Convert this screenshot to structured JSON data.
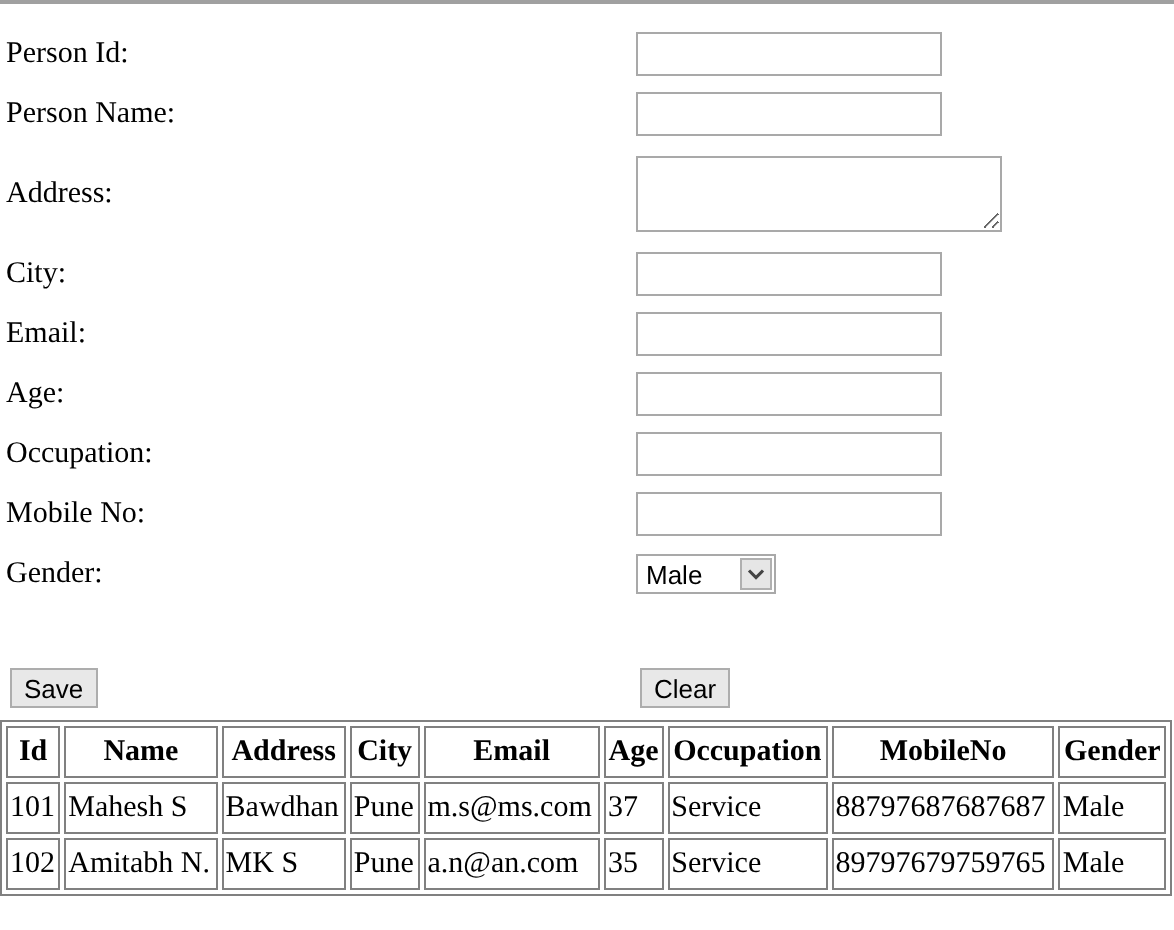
{
  "form": {
    "fields": [
      {
        "label": "Person Id:",
        "kind": "text"
      },
      {
        "label": "Person Name:",
        "kind": "text"
      },
      {
        "label": "Address:",
        "kind": "textarea"
      },
      {
        "label": "City:",
        "kind": "text"
      },
      {
        "label": "Email:",
        "kind": "text"
      },
      {
        "label": "Age:",
        "kind": "text"
      },
      {
        "label": "Occupation:",
        "kind": "text"
      },
      {
        "label": "Mobile No:",
        "kind": "text"
      },
      {
        "label": "Gender:",
        "kind": "select",
        "value": "Male"
      }
    ],
    "buttons": [
      "Save",
      "Clear"
    ]
  },
  "table": {
    "columns": [
      "Id",
      "Name",
      "Address",
      "City",
      "Email",
      "Age",
      "Occupation",
      "MobileNo",
      "Gender"
    ],
    "rows": [
      [
        "101",
        "Mahesh S",
        "Bawdhan",
        "Pune",
        "m.s@ms.com",
        "37",
        "Service",
        "88797687687687",
        "Male"
      ],
      [
        "102",
        "Amitabh N.",
        "MK S",
        "Pune",
        "a.n@an.com",
        "35",
        "Service",
        "89797679759765",
        "Male"
      ]
    ]
  }
}
